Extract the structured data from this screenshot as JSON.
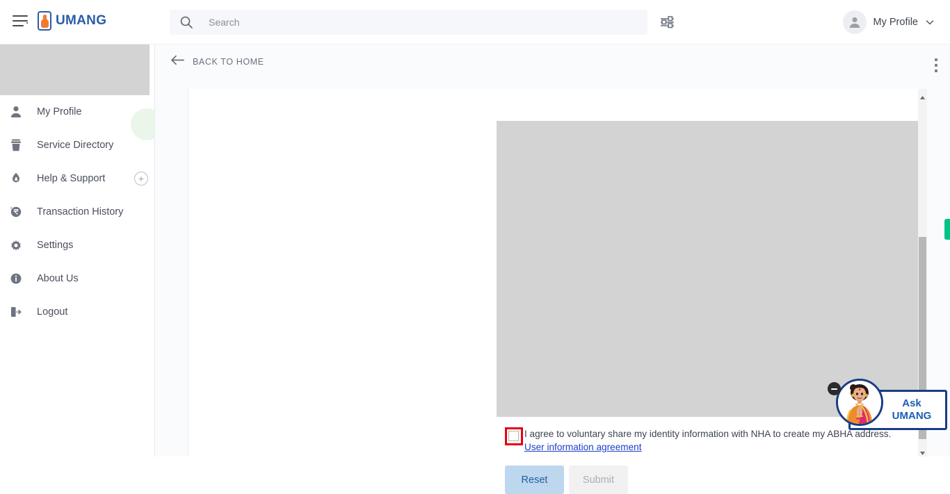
{
  "header": {
    "menu_icon": "hamburger-icon",
    "brand": "UMANG",
    "search": {
      "placeholder": "Search",
      "value": "",
      "icon": "search-icon"
    },
    "filter_icon": "filter-sliders-icon",
    "profile": {
      "name": "My Profile",
      "avatar_icon": "user-avatar-icon",
      "chevron_icon": "chevron-down-icon"
    }
  },
  "sidebar": {
    "items": [
      {
        "label": "My Profile",
        "icon": "user-icon",
        "has_plus": false
      },
      {
        "label": "Service Directory",
        "icon": "directory-icon",
        "has_plus": false
      },
      {
        "label": "Help & Support",
        "icon": "help-hand-icon",
        "has_plus": true,
        "plus_icon": "plus-circle-icon"
      },
      {
        "label": "Transaction History",
        "icon": "history-rupee-icon",
        "has_plus": false
      },
      {
        "label": "Settings",
        "icon": "gear-icon",
        "has_plus": false
      },
      {
        "label": "About Us",
        "icon": "info-icon",
        "has_plus": false
      },
      {
        "label": "Logout",
        "icon": "logout-icon",
        "has_plus": false
      }
    ]
  },
  "main": {
    "back_label": "BACK TO HOME",
    "back_icon": "arrow-left-icon",
    "kebab_icon": "more-vertical-icon",
    "form": {
      "agreement_text": "I agree to voluntary share my identity information with NHA to create my ABHA address.",
      "agreement_link": "User information agreement",
      "checkbox_checked": false,
      "buttons": {
        "reset": "Reset",
        "submit": "Submit",
        "submit_disabled": true
      }
    }
  },
  "chat": {
    "line1": "Ask",
    "line2": "UMANG",
    "minimize_icon": "minimize-icon",
    "avatar_icon": "namaste-assistant-avatar"
  },
  "scroll": {
    "up_icon": "scroll-up-arrow",
    "down_icon": "scroll-down-arrow"
  },
  "colors": {
    "brand_blue": "#2a5caa",
    "brand_orange": "#f07c2e",
    "highlight_red": "#e8000d",
    "link_blue": "#1a3fcb",
    "reset_bg": "#bdd7ee",
    "green_tab": "#00c389"
  }
}
